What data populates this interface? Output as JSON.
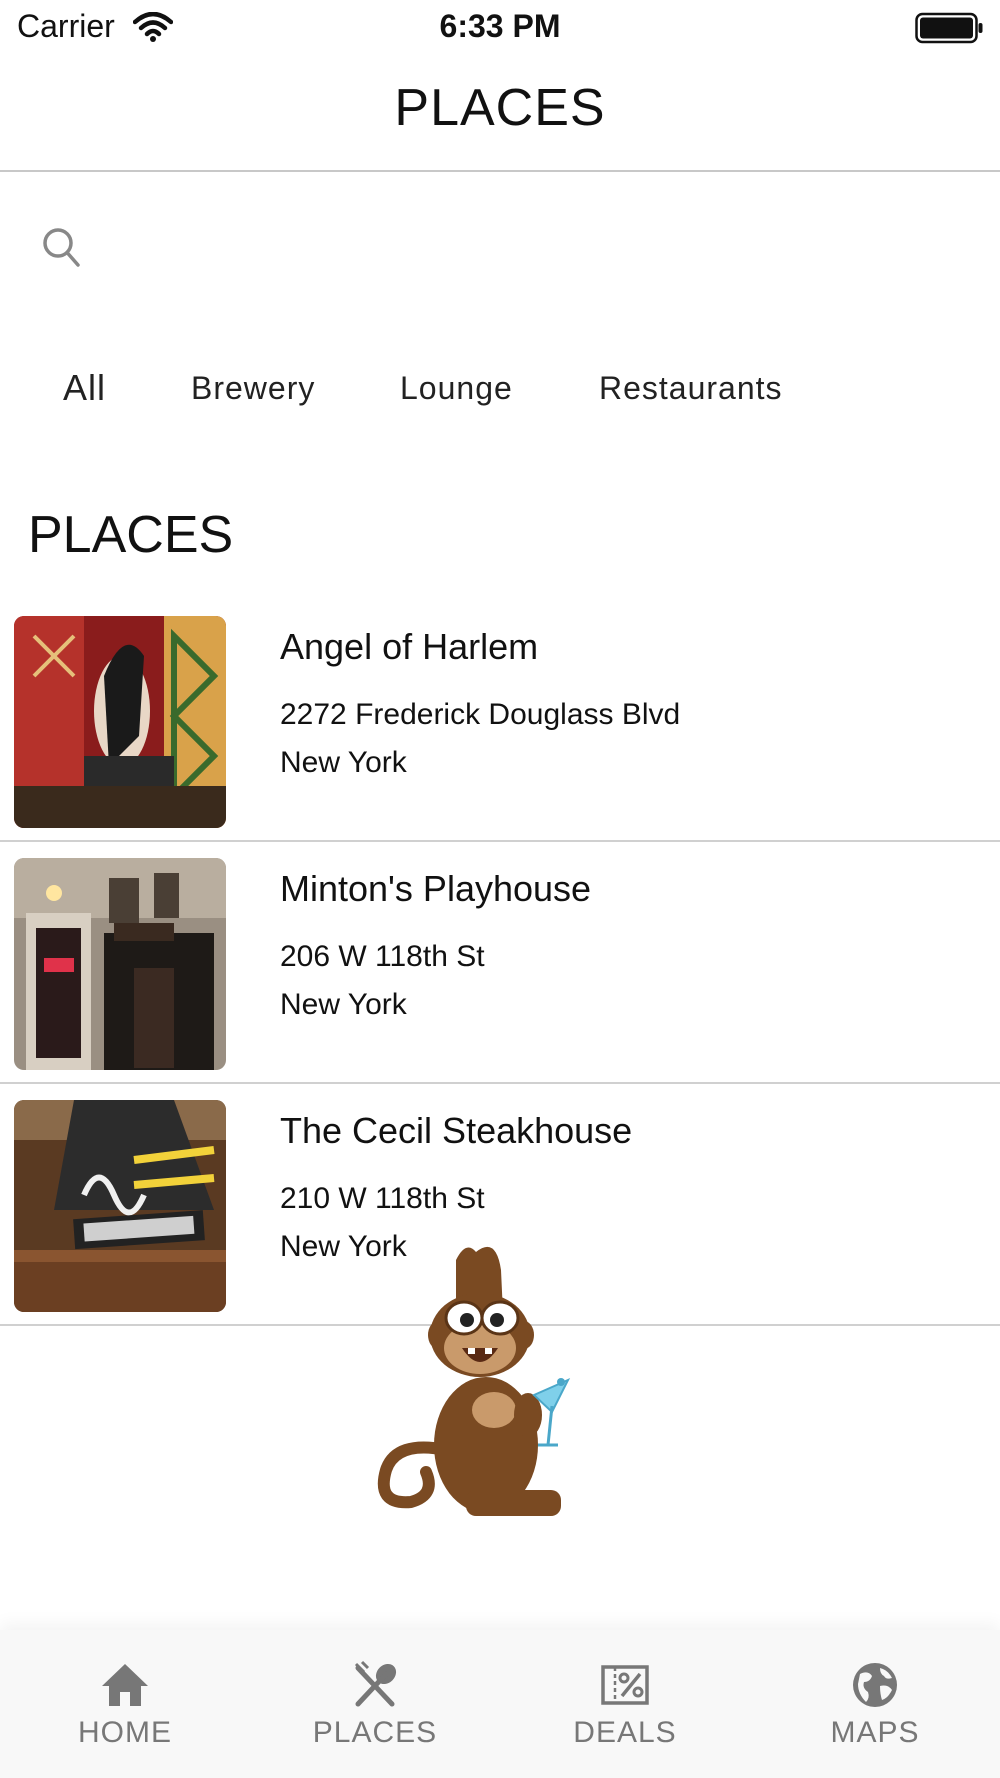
{
  "status_bar": {
    "carrier": "Carrier",
    "time": "6:33 PM"
  },
  "nav": {
    "title": "PLACES"
  },
  "search": {
    "value": "",
    "placeholder": ""
  },
  "filters": {
    "active": "All",
    "items": [
      {
        "label": "All"
      },
      {
        "label": "Brewery"
      },
      {
        "label": "Lounge"
      },
      {
        "label": "Restaurants"
      }
    ]
  },
  "section": {
    "title": "PLACES"
  },
  "places": [
    {
      "name": "Angel of Harlem",
      "address": "2272 Frederick Douglass Blvd",
      "city": "New York",
      "thumb_icon": "restaurant-interior-photo"
    },
    {
      "name": "Minton's Playhouse",
      "address": "206 W 118th St",
      "city": "New York",
      "thumb_icon": "building-facade-photo"
    },
    {
      "name": "The Cecil Steakhouse",
      "address": "210 W 118th St",
      "city": "New York",
      "thumb_icon": "bar-sign-photo"
    }
  ],
  "mascot": {
    "icon": "monkey-with-cocktail-icon"
  },
  "tab_bar": {
    "items": [
      {
        "label": "HOME",
        "icon": "home-icon"
      },
      {
        "label": "PLACES",
        "icon": "fork-spoon-icon"
      },
      {
        "label": "DEALS",
        "icon": "percent-ticket-icon"
      },
      {
        "label": "MAPS",
        "icon": "globe-icon"
      }
    ]
  },
  "colors": {
    "tab_inactive": "#777777",
    "divider": "#c8c8c8",
    "monkey_brown": "#7a4a22",
    "monkey_face": "#c99a6b"
  }
}
